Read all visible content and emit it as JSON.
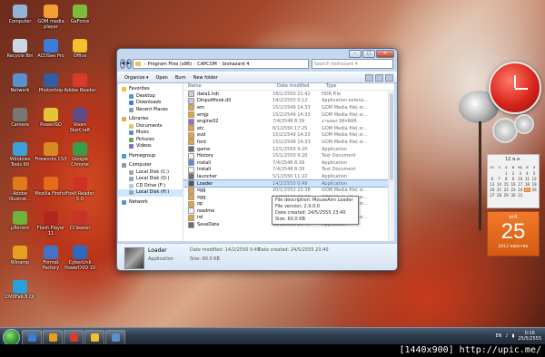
{
  "desktop": {
    "icons": [
      {
        "label": "Computer",
        "color": "#8fb3d9"
      },
      {
        "label": "GOM media player",
        "color": "#f0a030"
      },
      {
        "label": "GeForce",
        "color": "#7bbd3a"
      },
      {
        "label": "Recycle Bin",
        "color": "#c9d7e6"
      },
      {
        "label": "ACDSee Pro",
        "color": "#3b7dd8"
      },
      {
        "label": "Office",
        "color": "#f2c12e"
      },
      {
        "label": "Network",
        "color": "#5a8fd0"
      },
      {
        "label": "Photoshop",
        "color": "#2f5ea8"
      },
      {
        "label": "Adobe Reader",
        "color": "#d93b2b"
      },
      {
        "label": "Camera",
        "color": "#777777"
      },
      {
        "label": "PowerISO",
        "color": "#e6c43a"
      },
      {
        "label": "Vixen StarCraft",
        "color": "#5b4b8a"
      },
      {
        "label": "Windows Tools Kit",
        "color": "#3da0d8"
      },
      {
        "label": "Fireworks CS3",
        "color": "#d58b22"
      },
      {
        "label": "Google Chrome",
        "color": "#3a9b4a"
      },
      {
        "label": "Adobe Illustrat...",
        "color": "#e07b1a"
      },
      {
        "label": "Mozilla Firefox",
        "color": "#e56a1c"
      },
      {
        "label": "Foxit Reader 5.0",
        "color": "#cf3124"
      },
      {
        "label": "µTorrent",
        "color": "#6fb33a"
      },
      {
        "label": "Flash Player 11",
        "color": "#b3261e"
      },
      {
        "label": "CCleaner",
        "color": "#c6342a"
      },
      {
        "label": "Winamp",
        "color": "#e6a020"
      },
      {
        "label": "Format Factory",
        "color": "#4472c4"
      },
      {
        "label": "CyberLink PowerDVD 10",
        "color": "#2f6ac2"
      },
      {
        "label": "DVDFab 8 Qt",
        "color": "#2aa0d8"
      }
    ]
  },
  "window": {
    "path": [
      "Program Files (x86)",
      "CAPCOM",
      "biohazard 4"
    ],
    "search_placeholder": "Search biohazard 4",
    "toolbar": [
      "Organize ▾",
      "Open",
      "Burn",
      "New folder"
    ],
    "nav": {
      "favorites": {
        "label": "Favorites",
        "items": [
          "Desktop",
          "Downloads",
          "Recent Places"
        ]
      },
      "libraries": {
        "label": "Libraries",
        "items": [
          "Documents",
          "Music",
          "Pictures",
          "Videos"
        ]
      },
      "homegroup": "Homegroup",
      "computer": {
        "label": "Computer",
        "items": [
          "Local Disk (C:)",
          "Local Disk (D:)",
          "CD Drive (F:)",
          "Local Disk (H:)"
        ]
      },
      "network": "Network"
    },
    "columns": [
      "Name",
      "Date modified",
      "Type"
    ],
    "files": [
      {
        "name": "data1.hdr",
        "date": "18/1/2550 21:42",
        "type": "HDR File",
        "color": "#cfcfcf"
      },
      {
        "name": "DInputHook.dll",
        "date": "14/2/2550 0:12",
        "type": "Application extens...",
        "color": "#c8c8d8"
      },
      {
        "name": "em",
        "date": "15/2/2549 14:33",
        "type": "GOM Media file(.sr...",
        "color": "#e5a53a"
      },
      {
        "name": "emjp",
        "date": "15/2/2549 14:33",
        "type": "GOM Media file(.sr...",
        "color": "#e5a53a"
      },
      {
        "name": "engine32",
        "date": "7/4/2548 8:39",
        "type": "งานของ WinRAR",
        "color": "#9b6fbd"
      },
      {
        "name": "etc",
        "date": "8/1/2550 17:25",
        "type": "GOM Media file(.sr...",
        "color": "#e5a53a"
      },
      {
        "name": "evd",
        "date": "15/2/2549 14:33",
        "type": "GOM Media file(.sr...",
        "color": "#e5a53a"
      },
      {
        "name": "font",
        "date": "15/2/2549 14:33",
        "type": "GOM Media file(.sr...",
        "color": "#e5a53a"
      },
      {
        "name": "game",
        "date": "12/1/2550 9:20",
        "type": "Application",
        "color": "#6f6f6f"
      },
      {
        "name": "History",
        "date": "15/1/2550 9:20",
        "type": "Text Document",
        "color": "#f2f2f2"
      },
      {
        "name": "install",
        "date": "7/4/2548 8:39",
        "type": "Application",
        "color": "#5c8fd0"
      },
      {
        "name": "Install",
        "date": "7/4/2548 8:39",
        "type": "Text Document",
        "color": "#f2f2f2"
      },
      {
        "name": "launcher",
        "date": "5/1/2550 11:22",
        "type": "Application",
        "color": "#6f6f6f"
      },
      {
        "name": "Loader",
        "date": "14/2/2550 0:49",
        "type": "Application",
        "color": "#555555"
      },
      {
        "name": "ogg",
        "date": "20/1/2552 23:38",
        "type": "GOM Media file(.sr...",
        "color": "#e5a53a"
      },
      {
        "name": "ogg",
        "date": "14/2/2549 20:29",
        "type": "GOM Media file(.sr...",
        "color": "#e5a53a"
      },
      {
        "name": "op",
        "date": "18/1/2550 21:46",
        "type": "GOM Media file(.sr...",
        "color": "#e5a53a"
      },
      {
        "name": "readme",
        "date": "14/2/2550 0:54",
        "type": "Text Document",
        "color": "#f2f2f2"
      },
      {
        "name": "rel",
        "date": "15/2/2549 14:33",
        "type": "GOM Media file(.sr...",
        "color": "#e5a53a"
      },
      {
        "name": "SaveData",
        "date": "13/1/2550 20:44",
        "type": "Application",
        "color": "#6f6f6f"
      }
    ],
    "selected_file_index": 13,
    "tooltip": [
      "File description: MouseAim Loader",
      "File version: 2.0.0.0",
      "Date created: 24/5/2555 23:40",
      "Size: 60.0 KB"
    ],
    "details": {
      "name": "Loader",
      "type": "Application",
      "modified": "Date modified: 14/2/2550 0:49",
      "size": "Size: 60.0 KB",
      "created": "Date created: 24/5/2555 23:40"
    }
  },
  "calendar": {
    "month_year": "12 พ.ค.",
    "weekdays": [
      "อา",
      "จ",
      "อ",
      "พ",
      "พฤ",
      "ศ",
      "ส"
    ],
    "days": [
      "",
      "",
      "1",
      "2",
      "3",
      "4",
      "5",
      "6",
      "7",
      "8",
      "9",
      "10",
      "11",
      "12",
      "13",
      "14",
      "15",
      "16",
      "17",
      "18",
      "19",
      "20",
      "21",
      "22",
      "23",
      "24",
      "25",
      "26",
      "27",
      "28",
      "29",
      "30",
      "31",
      "",
      "",
      ""
    ],
    "today_dow": "ศุกร์",
    "today": "25",
    "today_caption": "2012 พฤษภาคม"
  },
  "taskbar": {
    "items": [
      {
        "color": "#3b7dd8"
      },
      {
        "color": "#e6a020"
      },
      {
        "color": "#d93b2b"
      },
      {
        "color": "#f2c12e"
      },
      {
        "color": "#5a8fd0"
      }
    ],
    "lang": "EN",
    "time": "0:16",
    "date": "25/5/2555"
  },
  "watermark": "[1440x900] http://upic.me/"
}
